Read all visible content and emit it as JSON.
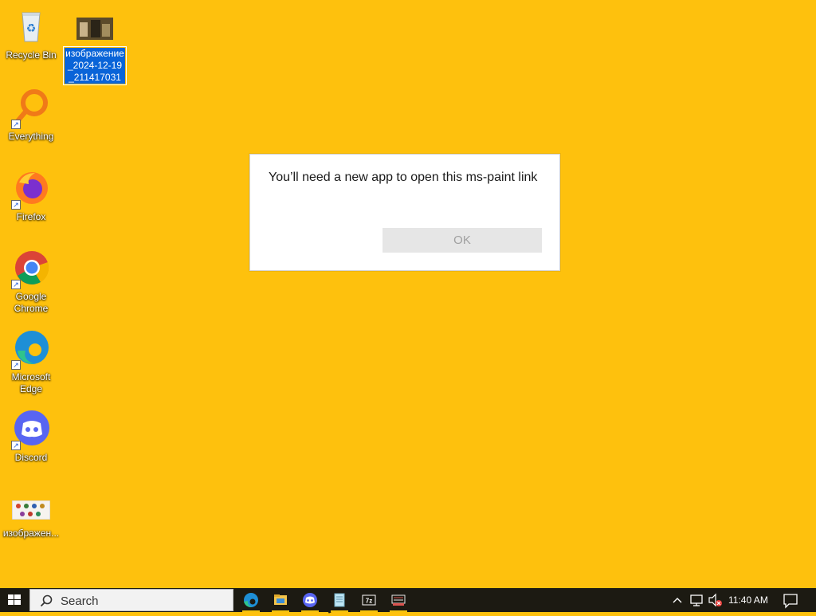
{
  "desktop": {
    "background": "#FEC10D",
    "icons": [
      {
        "label": "Recycle Bin"
      },
      {
        "label": "изображение_2024-12-19_211417031"
      },
      {
        "label": "Everything"
      },
      {
        "label": "Firefox"
      },
      {
        "label": "Google Chrome"
      },
      {
        "label": "Microsoft Edge"
      },
      {
        "label": "Discord"
      },
      {
        "label": "изображен..."
      }
    ]
  },
  "dialog": {
    "message": "You’ll need a new app to open this ms-paint link",
    "ok_label": "OK"
  },
  "taskbar": {
    "search_placeholder": "Search",
    "apps": [
      "edge-icon",
      "file-explorer-icon",
      "discord-icon",
      "notepad-icon",
      "7zip-icon",
      "app-icon"
    ],
    "clock": "11:40 AM"
  }
}
